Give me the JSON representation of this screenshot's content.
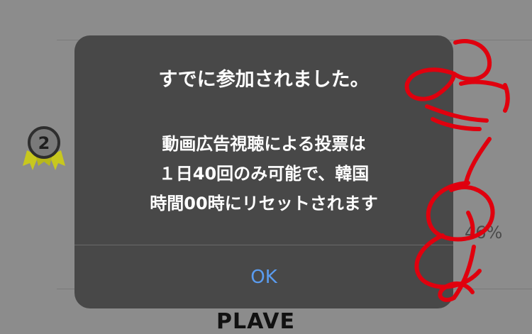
{
  "background": {
    "rank_number": "2",
    "percent": "46%",
    "bottom_label": "PLAVE"
  },
  "alert": {
    "title": "すでに参加されました。",
    "message_lines": [
      "動画広告視聴による投票は",
      "１日40回のみ可能で、韓国",
      "時間00時にリセットされます"
    ],
    "ok_label": "OK"
  },
  "colors": {
    "alert_bg": "#484848",
    "ok_text": "#5a9cf0",
    "scribble": "#e0000e",
    "badge_ribbon": "#c8c81e"
  }
}
